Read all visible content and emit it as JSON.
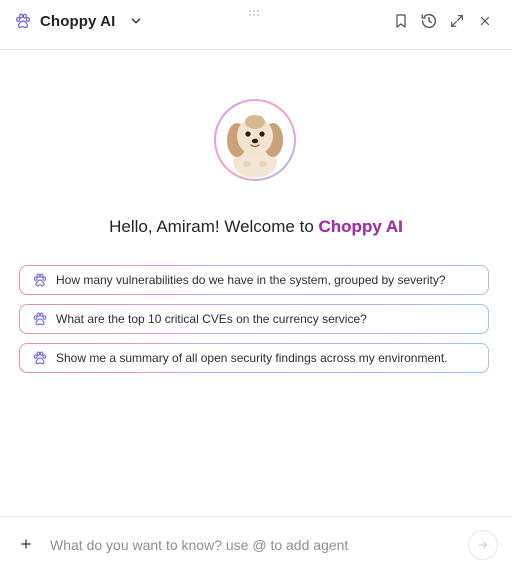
{
  "header": {
    "title": "Choppy AI",
    "icons": [
      "paw-icon",
      "chevron-down-icon",
      "bookmark-icon",
      "history-icon",
      "expand-icon",
      "close-icon",
      "drag-handle-icon"
    ]
  },
  "welcome": {
    "greeting": "Hello, Amiram! Welcome to ",
    "brand": "Choppy AI"
  },
  "suggestions": [
    {
      "label": "How many vulnerabilities do we have in the system, grouped by severity?"
    },
    {
      "label": "What are the top 10 critical CVEs on the currency service?"
    },
    {
      "label": "Show me a summary of all open security findings across my environment."
    }
  ],
  "composer": {
    "placeholder": "What do you want to know? use @ to add agent",
    "value": ""
  },
  "colors": {
    "accent": "#a0329f",
    "border": "#e7e8ec",
    "text": "#1f2328"
  }
}
